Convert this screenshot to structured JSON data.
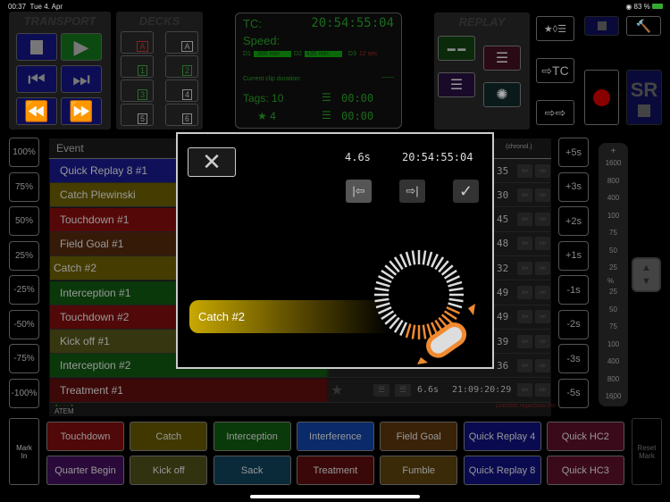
{
  "status_bar": {
    "time": "00:37",
    "date": "Tue 4. Apr",
    "battery": "83 %"
  },
  "transport": {
    "title": "TRANSPORT"
  },
  "decks": {
    "title": "DECKS",
    "items": [
      "A",
      "A",
      "1",
      "2",
      "3",
      "4",
      "5",
      "6"
    ]
  },
  "tc_panel": {
    "tc_label": "TC:",
    "tc_value": "20:54:55:04",
    "speed_label": "Speed:",
    "d1_label": "D1",
    "d1_value": "360 min",
    "d2_label": "D2",
    "d2_value": "435 min",
    "d3_label": "D3",
    "d3_value": "12 sec",
    "clip_duration_label": "Current clip duration:",
    "clip_duration_value": "——",
    "tags_label": "Tags: 10",
    "tags_time": "00:00",
    "star_count": "4",
    "star_time": "00:00"
  },
  "replay": {
    "title": "REPLAY"
  },
  "right_buttons": {
    "tc_label": "TC",
    "sr_label": "SR"
  },
  "percent_buttons": [
    "100%",
    "75%",
    "50%",
    "25%",
    "-25%",
    "-50%",
    "-75%",
    "-100%"
  ],
  "second_buttons": [
    "+5s",
    "+3s",
    "+2s",
    "+1s",
    "-1s",
    "-2s",
    "-3s",
    "-5s"
  ],
  "speed_scale": {
    "plus": "+",
    "minus": "-",
    "unit": "%",
    "top": [
      "1600",
      "800",
      "400",
      "100",
      "75",
      "50",
      "25"
    ],
    "bottom": [
      "25",
      "50",
      "75",
      "100",
      "400",
      "800",
      "1600"
    ]
  },
  "table": {
    "header_event": "Event",
    "header_sort": "(chronol.)",
    "header_time_fragment": "e",
    "rows": [
      {
        "label": "Quick Replay 8 #1",
        "color": "#10105a",
        "time": "35"
      },
      {
        "label": "Catch Plewinski",
        "color": "#443c00",
        "time": "30"
      },
      {
        "label": "Touchdown #1",
        "color": "#550808",
        "time": "45"
      },
      {
        "label": "Field Goal #1",
        "color": "#361a08",
        "time": "48"
      },
      {
        "label": "Catch #2",
        "color": "#443c00",
        "time": "32",
        "selected": true
      },
      {
        "label": "Interception #1",
        "color": "#0a380a",
        "time": "49"
      },
      {
        "label": "Touchdown #2",
        "color": "#500808",
        "time": "49"
      },
      {
        "label": "Kick off #1",
        "color": "#363610",
        "time": "39"
      },
      {
        "label": "Interception #2",
        "color": "#0a380a",
        "time": "36"
      },
      {
        "label": "Treatment #1",
        "color": "#3c0808",
        "time": "21:09:20:29",
        "duration": "6.6s"
      }
    ],
    "footer_source": "ATEM",
    "footer_brand": "LiveSkills HyperSlow Pro"
  },
  "modal": {
    "duration": "4.6s",
    "timecode": "20:54:55:04",
    "clip_label": "Catch #2",
    "accent": "#f08a30"
  },
  "mark_in": "Mark In",
  "reset_mark": "Reset Mark",
  "quick_buttons": [
    {
      "label": "Touchdown",
      "color": "#500808"
    },
    {
      "label": "Catch",
      "color": "#403800"
    },
    {
      "label": "Interception",
      "color": "#0a3a0a"
    },
    {
      "label": "Interference",
      "color": "#0a2a6a"
    },
    {
      "label": "Field Goal",
      "color": "#3a2208"
    },
    {
      "label": "Quick Replay 4",
      "color": "#0a0a50"
    },
    {
      "label": "Quick HC2",
      "color": "#3a0a1a"
    },
    {
      "label": "Quarter Begin",
      "color": "#2a0a3a"
    },
    {
      "label": "Kick off",
      "color": "#303210"
    },
    {
      "label": "Sack",
      "color": "#0a2a3a"
    },
    {
      "label": "Treatment",
      "color": "#3a0808"
    },
    {
      "label": "Fumble",
      "color": "#3a2a08"
    },
    {
      "label": "Quick Replay 8",
      "color": "#0a0a50"
    },
    {
      "label": "Quick HC3",
      "color": "#3a0a1a"
    }
  ]
}
